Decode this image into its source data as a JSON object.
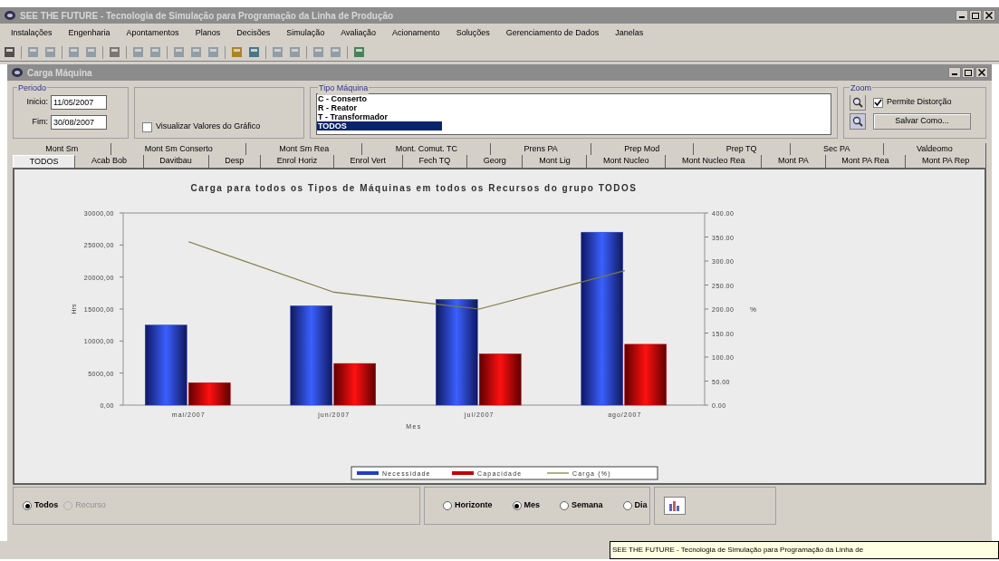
{
  "window": {
    "title": "SEE THE FUTURE - Tecnologia de Simulação para Programação da Linha de Produção"
  },
  "menu": [
    "Instalações",
    "Engenharia",
    "Apontamentos",
    "Planos",
    "Decisões",
    "Simulação",
    "Avaliação",
    "Acionamento",
    "Soluções",
    "Gerenciamento de Dados",
    "Janelas"
  ],
  "child_window": {
    "title": "Carga Máquina"
  },
  "periodo": {
    "label": "Periodo",
    "inicio_label": "Inicio:",
    "inicio": "11/05/2007",
    "fim_label": "Fim:",
    "fim": "30/08/2007"
  },
  "show_values": {
    "label": "Visualizar Valores do Gráfico",
    "checked": false
  },
  "tipo_maquina": {
    "label": "Tipo Máquina",
    "items": [
      {
        "text": "C - Conserto",
        "selected": false
      },
      {
        "text": "R - Reator",
        "selected": false
      },
      {
        "text": "T - Transformador",
        "selected": false
      },
      {
        "text": "TODOS",
        "selected": true
      }
    ]
  },
  "zoom": {
    "label": "Zoom",
    "distortion": {
      "label": "Permite Distorção",
      "checked": true
    },
    "save_button": "Salvar Como..."
  },
  "tabs_row_1": [
    {
      "label": "Mont Sm",
      "selected": false
    },
    {
      "label": "Mont Sm Conserto",
      "selected": false
    },
    {
      "label": "Mont Sm Rea",
      "selected": false
    },
    {
      "label": "Mont. Comut. TC",
      "selected": false
    },
    {
      "label": "Prens PA",
      "selected": false
    },
    {
      "label": "Prep Mod",
      "selected": false
    },
    {
      "label": "Prep TQ",
      "selected": false
    },
    {
      "label": "Sec PA",
      "selected": false
    },
    {
      "label": "Valdeomo",
      "selected": false
    }
  ],
  "tabs_row_2": [
    {
      "label": "TODOS",
      "selected": true
    },
    {
      "label": "Acab Bob",
      "selected": false
    },
    {
      "label": "Davitbau",
      "selected": false
    },
    {
      "label": "Desp",
      "selected": false
    },
    {
      "label": "Enrol Horiz",
      "selected": false
    },
    {
      "label": "Enrol Vert",
      "selected": false
    },
    {
      "label": "Fech TQ",
      "selected": false
    },
    {
      "label": "Georg",
      "selected": false
    },
    {
      "label": "Mont Lig",
      "selected": false
    },
    {
      "label": "Mont Nucleo",
      "selected": false
    },
    {
      "label": "Mont Nucleo Rea",
      "selected": false
    },
    {
      "label": "Mont PA",
      "selected": false
    },
    {
      "label": "Mont PA Rea",
      "selected": false
    },
    {
      "label": "Mont PA Rep",
      "selected": false
    }
  ],
  "chart_data": {
    "type": "bar",
    "title": "Carga para todos os Tipos de Máquinas  em  todos os Recursos do grupo TODOS",
    "xlabel": "Mes",
    "ylabel": "Hrs",
    "y2label": "%",
    "categories": [
      "mai/2007",
      "jun/2007",
      "jul/2007",
      "ago/2007"
    ],
    "series": [
      {
        "name": "Necessidade",
        "color": "#2040c0",
        "values": [
          12500,
          15500,
          16500,
          27000
        ]
      },
      {
        "name": "Capacidade",
        "color": "#c00000",
        "values": [
          3500,
          6500,
          8000,
          9500
        ]
      },
      {
        "name": "Carga (%)",
        "color": "#7a7a40",
        "type": "line",
        "axis": "y2",
        "values": [
          340,
          235,
          200,
          280
        ]
      }
    ],
    "legend": true,
    "ylim": [
      0,
      30000
    ],
    "yticks": [
      {
        "value": 0,
        "label": "0,00"
      },
      {
        "value": 5000,
        "label": "5000,00"
      },
      {
        "value": 10000,
        "label": "10000,00"
      },
      {
        "value": 15000,
        "label": "15000,00"
      },
      {
        "value": 20000,
        "label": "20000,00"
      },
      {
        "value": 25000,
        "label": "25000,00"
      },
      {
        "value": 30000,
        "label": "30000,00"
      }
    ],
    "y2lim": [
      0,
      400
    ],
    "y2ticks": [
      {
        "value": 0,
        "label": "0.00"
      },
      {
        "value": 50,
        "label": "50.00"
      },
      {
        "value": 100,
        "label": "100.00"
      },
      {
        "value": 150,
        "label": "150.00"
      },
      {
        "value": 200,
        "label": "200.00"
      },
      {
        "value": 250,
        "label": "250.00"
      },
      {
        "value": 300,
        "label": "300.00"
      },
      {
        "value": 350,
        "label": "350.00"
      },
      {
        "value": 400,
        "label": "400.00"
      }
    ]
  },
  "scope": [
    {
      "label": "Todos",
      "selected": true,
      "disabled": false
    },
    {
      "label": "Recurso",
      "selected": false,
      "disabled": true
    }
  ],
  "granularity": [
    {
      "label": "Horizonte",
      "selected": false
    },
    {
      "label": "Mes",
      "selected": true
    },
    {
      "label": "Semana",
      "selected": false
    },
    {
      "label": "Dia",
      "selected": false
    }
  ],
  "status_tooltip": "SEE THE FUTURE - Tecnologia de Simulação para Programação da Linha de"
}
